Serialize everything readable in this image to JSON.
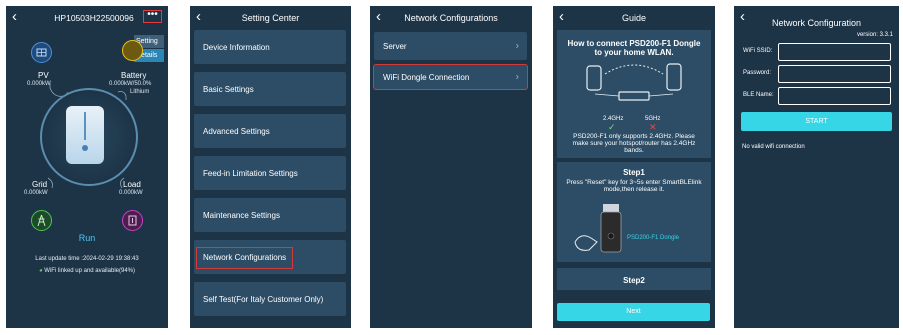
{
  "screen1": {
    "title": "HP10503H22500096",
    "menu_icon": "more-dots-icon",
    "popup": [
      "Setting",
      "Details"
    ],
    "pv": {
      "label": "PV",
      "value": "0.000kW"
    },
    "battery": {
      "label": "Battery",
      "value": "0.000kW/50.0%",
      "type": "Lithium"
    },
    "grid": {
      "label": "Grid",
      "value": "0.000kW"
    },
    "load": {
      "label": "Load",
      "value": "0.000kW"
    },
    "status": "Run",
    "last_update": "Last update time :2024-02-29 19:38:43",
    "wifi_status": "WiFi linked up and available(94%)"
  },
  "screen2": {
    "title": "Setting Center",
    "items": [
      "Device Information",
      "Basic Settings",
      "Advanced Settings",
      "Feed-in Limitation Settings",
      "Maintenance Settings",
      "Network Configurations",
      "Self Test(For Italy Customer Only)"
    ]
  },
  "screen3": {
    "title": "Network Configurations",
    "items": [
      "Server",
      "WiFi Dongle Connection"
    ]
  },
  "screen4": {
    "title": "Guide",
    "heading": "How to connect PSD200-F1 Dongle to your home WLAN.",
    "band_24": "2.4GHz",
    "band_5": "5GHz",
    "note": "PSD200-F1 only supports 2.4GHz. Please make sure your hotspot/router has 2.4GHz bands.",
    "step1_title": "Step1",
    "step1_text": "Press \"Reset\" key for 3~5s enter SmartBLElink mode,then release it.",
    "dongle_label": "PSD200-F1 Dongle",
    "step2_title": "Step2",
    "next": "Next"
  },
  "screen5": {
    "title": "Network Configuration",
    "version": "version: 3.3.1",
    "wifi_ssid_label": "WiFi SSID:",
    "password_label": "Password:",
    "ble_name_label": "BLE Name:",
    "start": "START",
    "status": "No valid wifi connection"
  }
}
